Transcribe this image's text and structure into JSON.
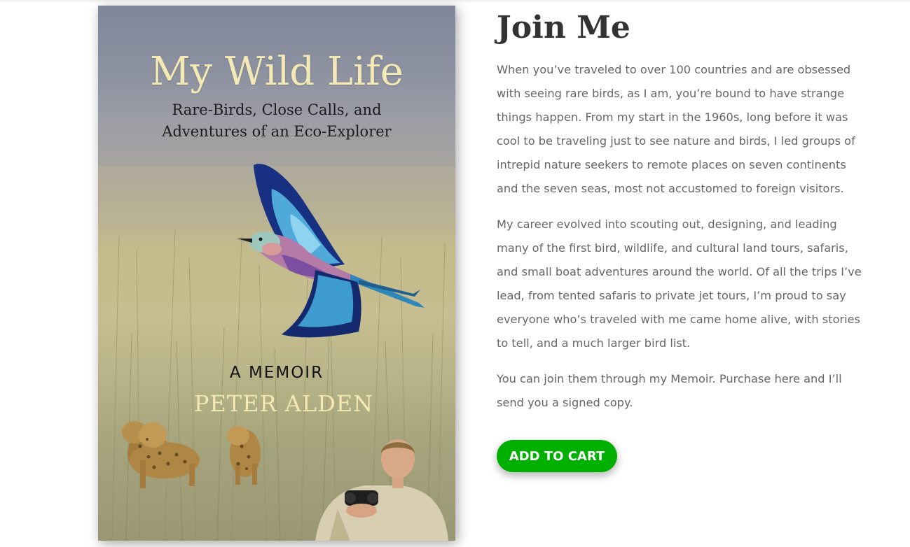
{
  "cover": {
    "title": "My Wild Life",
    "subtitle_line1": "Rare-Birds, Close Calls, and",
    "subtitle_line2": "Adventures of an Eco-Explorer",
    "tagline": "A MEMOIR",
    "author": "PETER ALDEN"
  },
  "section": {
    "heading": "Join Me",
    "paragraphs": [
      "When you’ve traveled to over 100 countries and are obsessed with seeing rare birds, as I am, you’re bound to have strange things happen. From my start in the 1960s, long before it was cool to be traveling just to see nature and birds, I led groups of intrepid nature seekers to remote places on seven continents and the seven seas, most not accustomed to foreign visitors.",
      "My career evolved into scouting out, designing, and leading many of the first bird, wildlife, and cultural land tours, safaris, and small boat adventures around the world. Of all the trips I’ve lead, from tented safaris to private jet tours, I’m proud to say everyone who’s traveled with me came home alive, with stories to tell, and a much larger bird list.",
      "You can join them through my Memoir. Purchase here and I’ll send you a signed copy."
    ]
  },
  "cart": {
    "button_label": "ADD TO CART",
    "button_color": "#00b000"
  }
}
